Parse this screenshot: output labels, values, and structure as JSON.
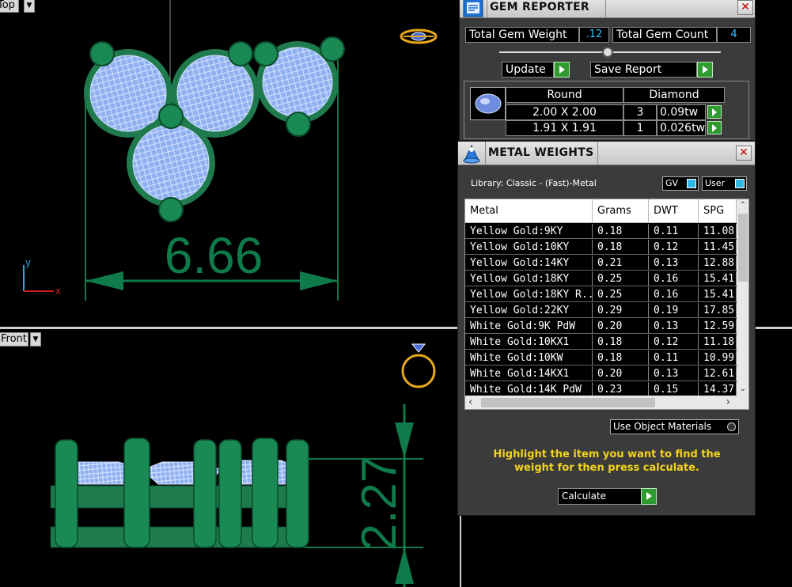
{
  "viewports": {
    "top_label": "Top",
    "front_label": "Front",
    "top_dimension": "6.66",
    "front_dimension": "2.27",
    "axis_y": "y",
    "axis_x": "x"
  },
  "gem_reporter": {
    "title": "GEM REPORTER",
    "total_weight_label": "Total Gem Weight",
    "total_weight_value": ".12",
    "total_count_label": "Total Gem Count",
    "total_count_value": "4",
    "update_label": "Update",
    "save_report_label": "Save Report",
    "columns": [
      "Round",
      "Diamond"
    ],
    "rows": [
      {
        "size": "2.00 X 2.00",
        "count": "3",
        "weight": "0.09tw"
      },
      {
        "size": "1.91 X 1.91",
        "count": "1",
        "weight": "0.026tw"
      }
    ]
  },
  "metal_weights": {
    "title": "METAL WEIGHTS",
    "library": "Library: Classic - (Fast)-Metal",
    "gv_label": "GV",
    "user_label": "User",
    "headers": [
      "Metal",
      "Grams",
      "DWT",
      "SPG"
    ],
    "rows": [
      [
        "Yellow Gold:9KY",
        "0.18",
        "0.11",
        "11.08"
      ],
      [
        "Yellow Gold:10KY",
        "0.18",
        "0.12",
        "11.45"
      ],
      [
        "Yellow Gold:14KY",
        "0.21",
        "0.13",
        "12.88"
      ],
      [
        "Yellow Gold:18KY",
        "0.25",
        "0.16",
        "15.41"
      ],
      [
        "Yellow Gold:18KY R...",
        "0.25",
        "0.16",
        "15.41"
      ],
      [
        "Yellow Gold:22KY",
        "0.29",
        "0.19",
        "17.85"
      ],
      [
        "White Gold:9K PdW",
        "0.20",
        "0.13",
        "12.59"
      ],
      [
        "White Gold:10KX1",
        "0.18",
        "0.12",
        "11.18"
      ],
      [
        "White Gold:10KW",
        "0.18",
        "0.11",
        "10.99"
      ],
      [
        "White Gold:14KX1",
        "0.20",
        "0.13",
        "12.61"
      ],
      [
        "White Gold:14K PdW",
        "0.23",
        "0.15",
        "14.37"
      ]
    ],
    "use_object_materials_label": "Use Object Materials",
    "instruction": "Highlight the item you want to find the weight for then press calculate.",
    "calculate_label": "Calculate"
  }
}
